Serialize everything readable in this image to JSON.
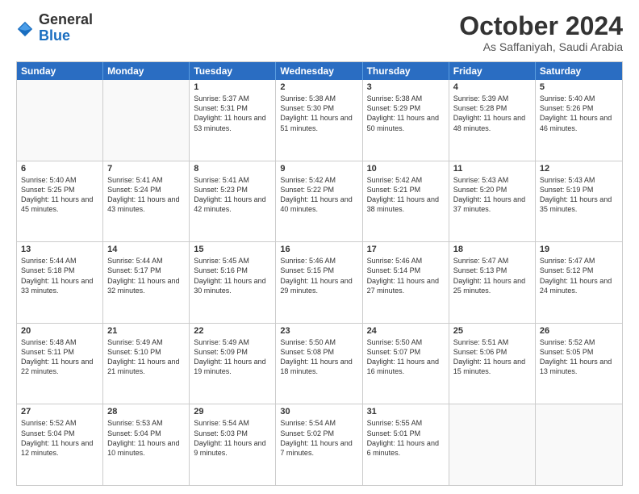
{
  "logo": {
    "general": "General",
    "blue": "Blue"
  },
  "header": {
    "month": "October 2024",
    "location": "As Saffaniyah, Saudi Arabia"
  },
  "weekdays": [
    "Sunday",
    "Monday",
    "Tuesday",
    "Wednesday",
    "Thursday",
    "Friday",
    "Saturday"
  ],
  "rows": [
    [
      {
        "day": "",
        "sunrise": "",
        "sunset": "",
        "daylight": "",
        "empty": true
      },
      {
        "day": "",
        "sunrise": "",
        "sunset": "",
        "daylight": "",
        "empty": true
      },
      {
        "day": "1",
        "sunrise": "Sunrise: 5:37 AM",
        "sunset": "Sunset: 5:31 PM",
        "daylight": "Daylight: 11 hours and 53 minutes.",
        "empty": false
      },
      {
        "day": "2",
        "sunrise": "Sunrise: 5:38 AM",
        "sunset": "Sunset: 5:30 PM",
        "daylight": "Daylight: 11 hours and 51 minutes.",
        "empty": false
      },
      {
        "day": "3",
        "sunrise": "Sunrise: 5:38 AM",
        "sunset": "Sunset: 5:29 PM",
        "daylight": "Daylight: 11 hours and 50 minutes.",
        "empty": false
      },
      {
        "day": "4",
        "sunrise": "Sunrise: 5:39 AM",
        "sunset": "Sunset: 5:28 PM",
        "daylight": "Daylight: 11 hours and 48 minutes.",
        "empty": false
      },
      {
        "day": "5",
        "sunrise": "Sunrise: 5:40 AM",
        "sunset": "Sunset: 5:26 PM",
        "daylight": "Daylight: 11 hours and 46 minutes.",
        "empty": false
      }
    ],
    [
      {
        "day": "6",
        "sunrise": "Sunrise: 5:40 AM",
        "sunset": "Sunset: 5:25 PM",
        "daylight": "Daylight: 11 hours and 45 minutes.",
        "empty": false
      },
      {
        "day": "7",
        "sunrise": "Sunrise: 5:41 AM",
        "sunset": "Sunset: 5:24 PM",
        "daylight": "Daylight: 11 hours and 43 minutes.",
        "empty": false
      },
      {
        "day": "8",
        "sunrise": "Sunrise: 5:41 AM",
        "sunset": "Sunset: 5:23 PM",
        "daylight": "Daylight: 11 hours and 42 minutes.",
        "empty": false
      },
      {
        "day": "9",
        "sunrise": "Sunrise: 5:42 AM",
        "sunset": "Sunset: 5:22 PM",
        "daylight": "Daylight: 11 hours and 40 minutes.",
        "empty": false
      },
      {
        "day": "10",
        "sunrise": "Sunrise: 5:42 AM",
        "sunset": "Sunset: 5:21 PM",
        "daylight": "Daylight: 11 hours and 38 minutes.",
        "empty": false
      },
      {
        "day": "11",
        "sunrise": "Sunrise: 5:43 AM",
        "sunset": "Sunset: 5:20 PM",
        "daylight": "Daylight: 11 hours and 37 minutes.",
        "empty": false
      },
      {
        "day": "12",
        "sunrise": "Sunrise: 5:43 AM",
        "sunset": "Sunset: 5:19 PM",
        "daylight": "Daylight: 11 hours and 35 minutes.",
        "empty": false
      }
    ],
    [
      {
        "day": "13",
        "sunrise": "Sunrise: 5:44 AM",
        "sunset": "Sunset: 5:18 PM",
        "daylight": "Daylight: 11 hours and 33 minutes.",
        "empty": false
      },
      {
        "day": "14",
        "sunrise": "Sunrise: 5:44 AM",
        "sunset": "Sunset: 5:17 PM",
        "daylight": "Daylight: 11 hours and 32 minutes.",
        "empty": false
      },
      {
        "day": "15",
        "sunrise": "Sunrise: 5:45 AM",
        "sunset": "Sunset: 5:16 PM",
        "daylight": "Daylight: 11 hours and 30 minutes.",
        "empty": false
      },
      {
        "day": "16",
        "sunrise": "Sunrise: 5:46 AM",
        "sunset": "Sunset: 5:15 PM",
        "daylight": "Daylight: 11 hours and 29 minutes.",
        "empty": false
      },
      {
        "day": "17",
        "sunrise": "Sunrise: 5:46 AM",
        "sunset": "Sunset: 5:14 PM",
        "daylight": "Daylight: 11 hours and 27 minutes.",
        "empty": false
      },
      {
        "day": "18",
        "sunrise": "Sunrise: 5:47 AM",
        "sunset": "Sunset: 5:13 PM",
        "daylight": "Daylight: 11 hours and 25 minutes.",
        "empty": false
      },
      {
        "day": "19",
        "sunrise": "Sunrise: 5:47 AM",
        "sunset": "Sunset: 5:12 PM",
        "daylight": "Daylight: 11 hours and 24 minutes.",
        "empty": false
      }
    ],
    [
      {
        "day": "20",
        "sunrise": "Sunrise: 5:48 AM",
        "sunset": "Sunset: 5:11 PM",
        "daylight": "Daylight: 11 hours and 22 minutes.",
        "empty": false
      },
      {
        "day": "21",
        "sunrise": "Sunrise: 5:49 AM",
        "sunset": "Sunset: 5:10 PM",
        "daylight": "Daylight: 11 hours and 21 minutes.",
        "empty": false
      },
      {
        "day": "22",
        "sunrise": "Sunrise: 5:49 AM",
        "sunset": "Sunset: 5:09 PM",
        "daylight": "Daylight: 11 hours and 19 minutes.",
        "empty": false
      },
      {
        "day": "23",
        "sunrise": "Sunrise: 5:50 AM",
        "sunset": "Sunset: 5:08 PM",
        "daylight": "Daylight: 11 hours and 18 minutes.",
        "empty": false
      },
      {
        "day": "24",
        "sunrise": "Sunrise: 5:50 AM",
        "sunset": "Sunset: 5:07 PM",
        "daylight": "Daylight: 11 hours and 16 minutes.",
        "empty": false
      },
      {
        "day": "25",
        "sunrise": "Sunrise: 5:51 AM",
        "sunset": "Sunset: 5:06 PM",
        "daylight": "Daylight: 11 hours and 15 minutes.",
        "empty": false
      },
      {
        "day": "26",
        "sunrise": "Sunrise: 5:52 AM",
        "sunset": "Sunset: 5:05 PM",
        "daylight": "Daylight: 11 hours and 13 minutes.",
        "empty": false
      }
    ],
    [
      {
        "day": "27",
        "sunrise": "Sunrise: 5:52 AM",
        "sunset": "Sunset: 5:04 PM",
        "daylight": "Daylight: 11 hours and 12 minutes.",
        "empty": false
      },
      {
        "day": "28",
        "sunrise": "Sunrise: 5:53 AM",
        "sunset": "Sunset: 5:04 PM",
        "daylight": "Daylight: 11 hours and 10 minutes.",
        "empty": false
      },
      {
        "day": "29",
        "sunrise": "Sunrise: 5:54 AM",
        "sunset": "Sunset: 5:03 PM",
        "daylight": "Daylight: 11 hours and 9 minutes.",
        "empty": false
      },
      {
        "day": "30",
        "sunrise": "Sunrise: 5:54 AM",
        "sunset": "Sunset: 5:02 PM",
        "daylight": "Daylight: 11 hours and 7 minutes.",
        "empty": false
      },
      {
        "day": "31",
        "sunrise": "Sunrise: 5:55 AM",
        "sunset": "Sunset: 5:01 PM",
        "daylight": "Daylight: 11 hours and 6 minutes.",
        "empty": false
      },
      {
        "day": "",
        "sunrise": "",
        "sunset": "",
        "daylight": "",
        "empty": true
      },
      {
        "day": "",
        "sunrise": "",
        "sunset": "",
        "daylight": "",
        "empty": true
      }
    ]
  ]
}
